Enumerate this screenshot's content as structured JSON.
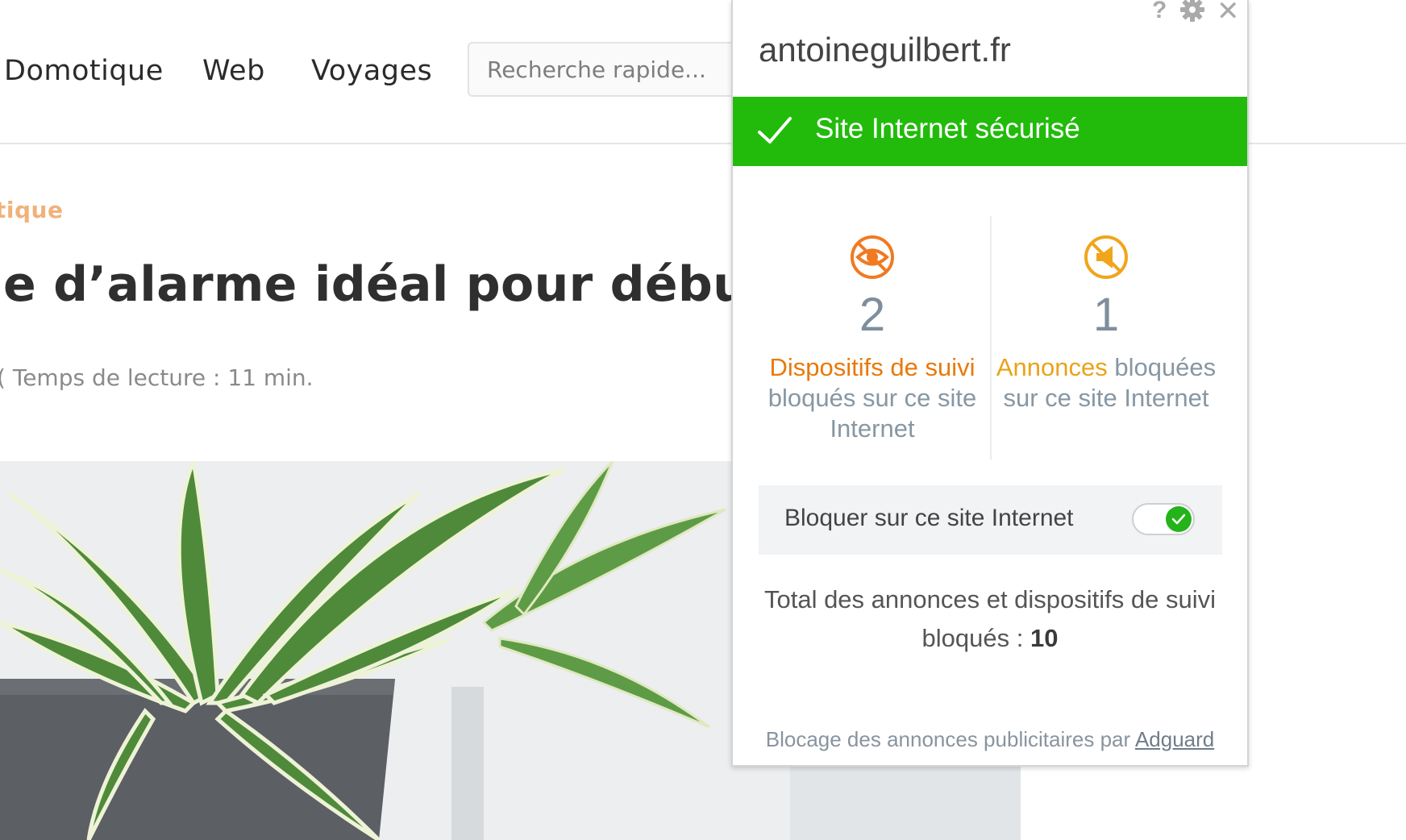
{
  "nav": {
    "items": [
      {
        "label": "Domotique"
      },
      {
        "label": "Web"
      },
      {
        "label": "Voyages"
      }
    ],
    "search_placeholder": "Recherche rapide..."
  },
  "article": {
    "category": "tique",
    "title": "e d’alarme idéal pour débuter",
    "reading_time": "Temps de lecture : 11 min."
  },
  "popup": {
    "domain": "antoineguilbert.fr",
    "status_banner": "Site Internet sécurisé",
    "trackers": {
      "count": "2",
      "highlight": "Dispositifs de suivi",
      "rest": " bloqués sur ce site Internet"
    },
    "ads": {
      "count": "1",
      "highlight": "Annonces",
      "rest": " bloquées sur ce site Internet"
    },
    "toggle": {
      "label": "Bloquer sur ce site Internet",
      "state": "on"
    },
    "total": {
      "prefix": "Total des annonces et dispositifs de suivi bloqués : ",
      "count": "10"
    },
    "footer": {
      "prefix": "Blocage des annonces publicitaires par ",
      "link": "Adguard"
    },
    "colors": {
      "banner": "#22bb0c",
      "trackers_accent": "#e8790a",
      "ads_accent": "#e9a31a",
      "toggle_on": "#24b31a"
    },
    "icons": [
      "help-icon",
      "gear-icon",
      "close-icon",
      "checkmark-icon",
      "eye-blocked-icon",
      "megaphone-blocked-icon"
    ]
  }
}
